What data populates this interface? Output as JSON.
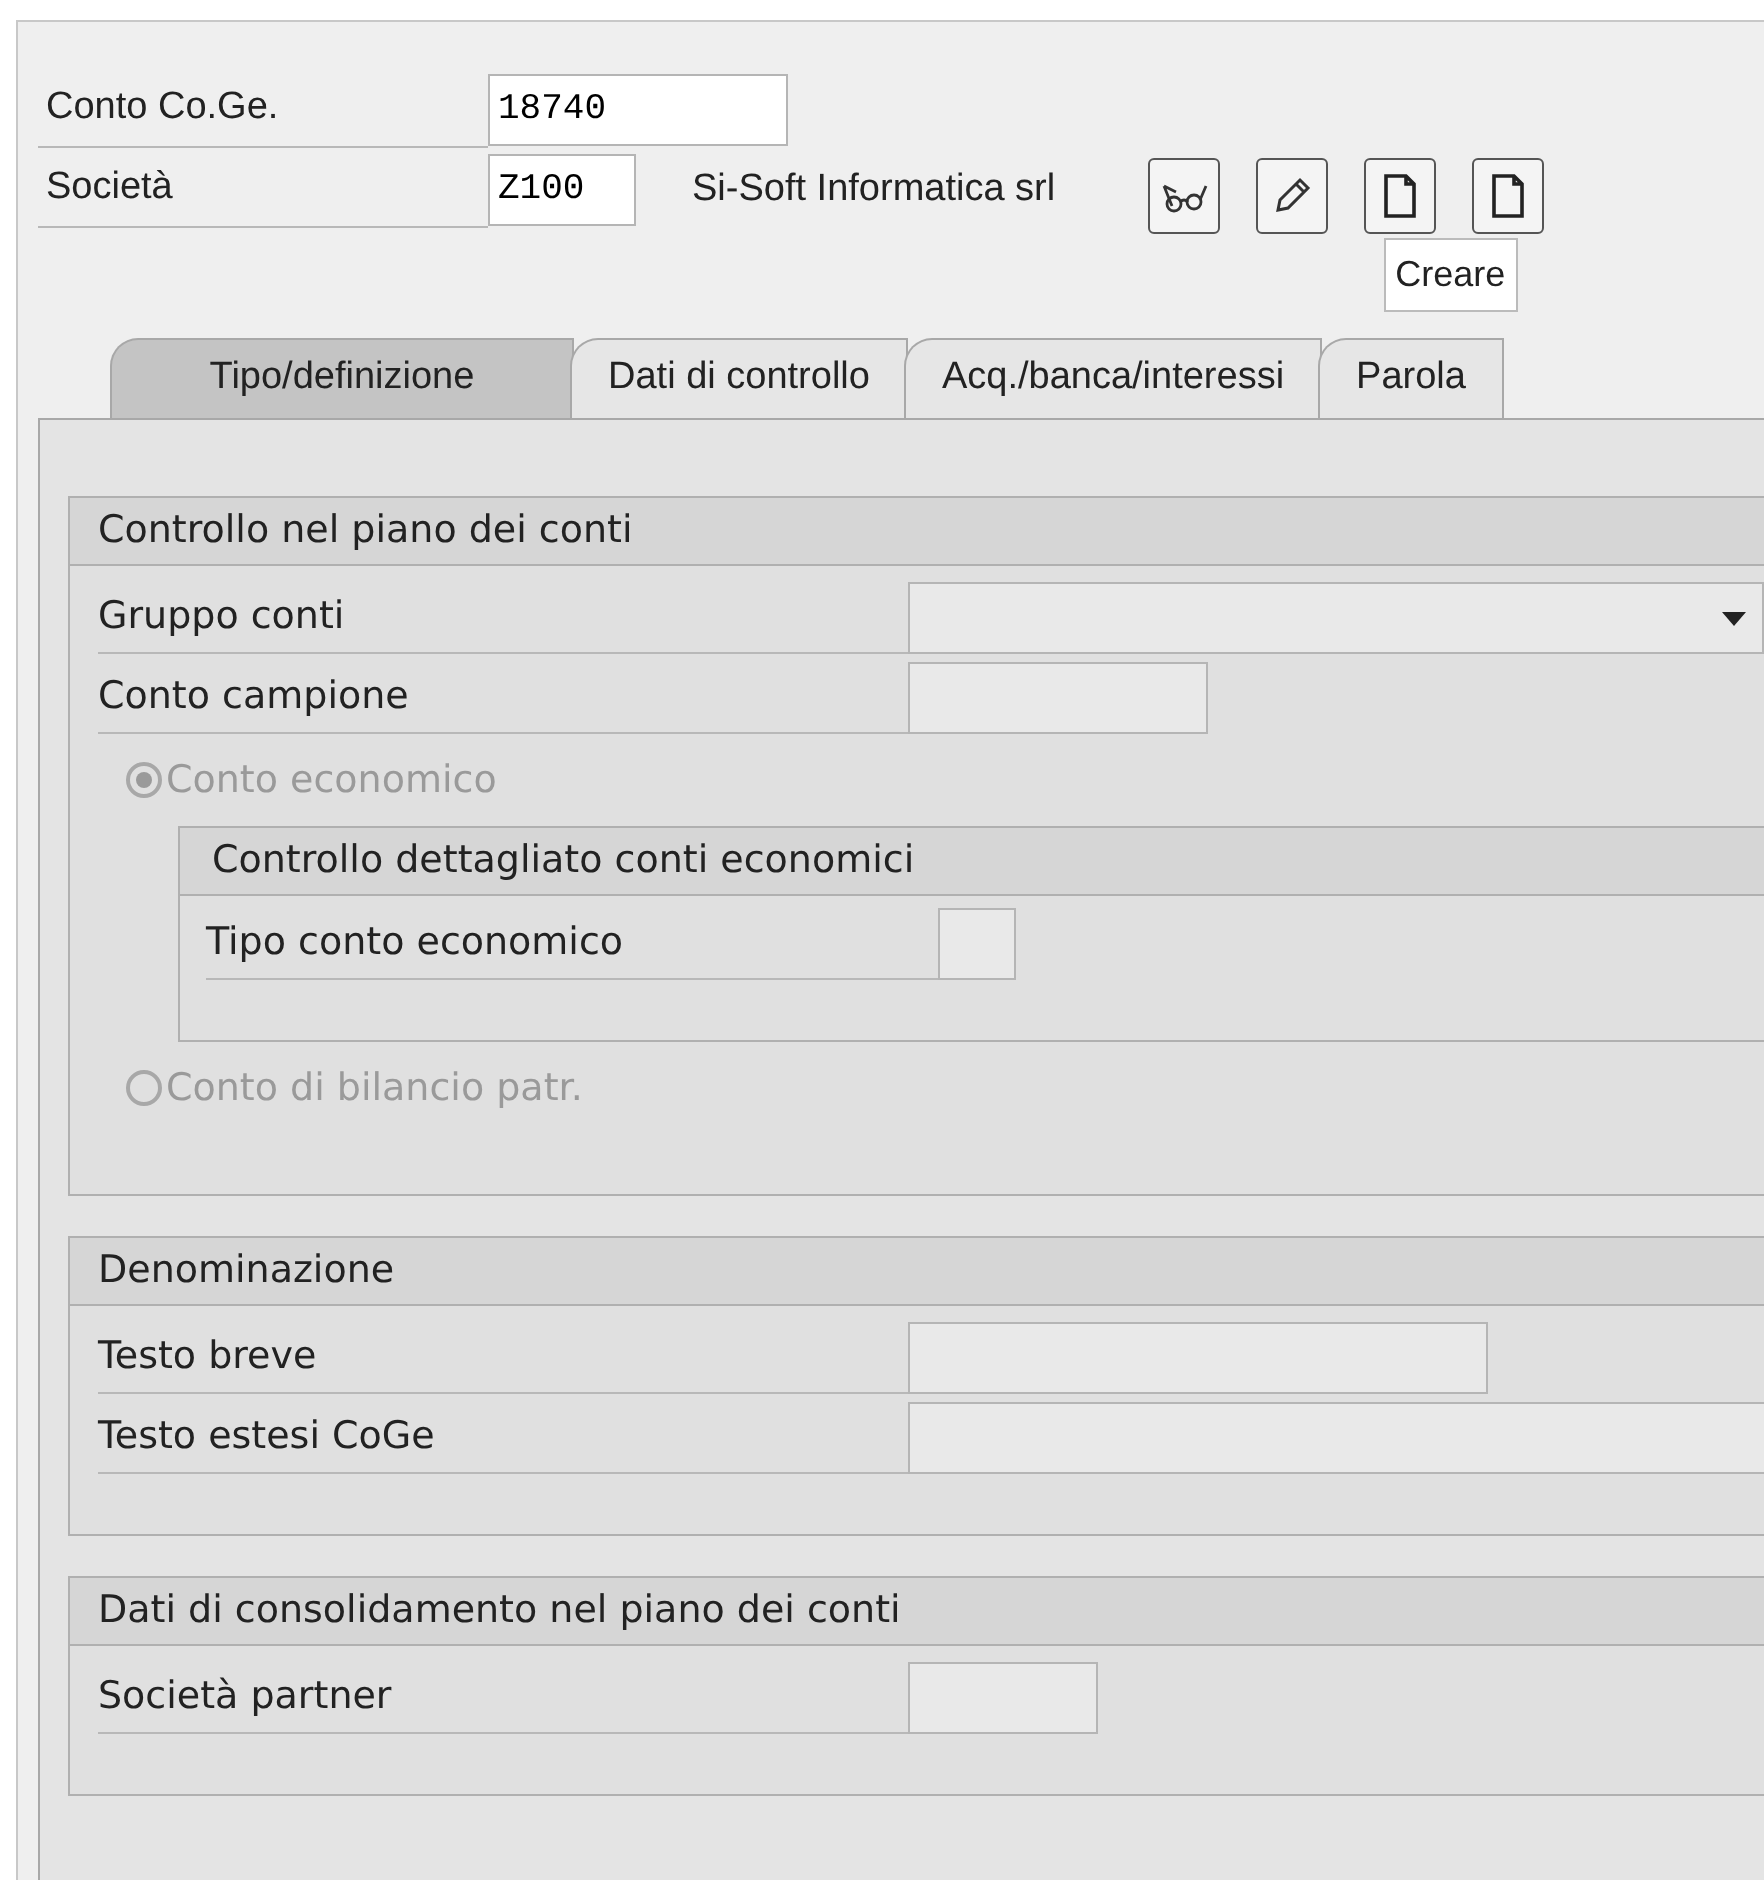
{
  "header_fields": [
    {
      "label": "Conto Co.Ge.",
      "value": "18740"
    },
    {
      "label": "Società",
      "value": "Z100",
      "description": "Si-Soft Informatica srl"
    }
  ],
  "toolbar": [
    {
      "kind": "display"
    },
    {
      "kind": "edit"
    },
    {
      "kind": "create"
    },
    {
      "kind": "create"
    }
  ],
  "tooltip": "Creare",
  "tabs": [
    {
      "label": "Tipo/definizione",
      "selected": true
    },
    {
      "label": "Dati di controllo",
      "selected": false
    },
    {
      "label": "Acq./banca/interessi",
      "selected": false
    },
    {
      "label": "Parola",
      "selected": false
    }
  ],
  "sections": [
    {
      "title": "Controllo nel piano dei conti",
      "items": [
        {
          "kind": "dropdown",
          "label": "Gruppo conti"
        },
        {
          "kind": "number_field",
          "label": "Conto campione"
        },
        {
          "kind": "radio",
          "label": "Conto economico",
          "selected": true,
          "disabled": true
        },
        {
          "kind": "group",
          "title": "Controllo dettagliato conti economici",
          "items": [
            {
              "kind": "code_field",
              "label": "Tipo conto economico"
            }
          ]
        },
        {
          "kind": "radio",
          "label": "Conto di bilancio patr.",
          "selected": false,
          "disabled": true
        }
      ]
    },
    {
      "title": "Denominazione",
      "items": [
        {
          "kind": "text_field",
          "label": "Testo breve"
        },
        {
          "kind": "long_text_field",
          "label": "Testo estesi CoGe"
        }
      ]
    },
    {
      "title": "Dati di consolidamento nel piano dei conti",
      "items": [
        {
          "kind": "key_field",
          "label": "Società partner"
        }
      ]
    }
  ]
}
